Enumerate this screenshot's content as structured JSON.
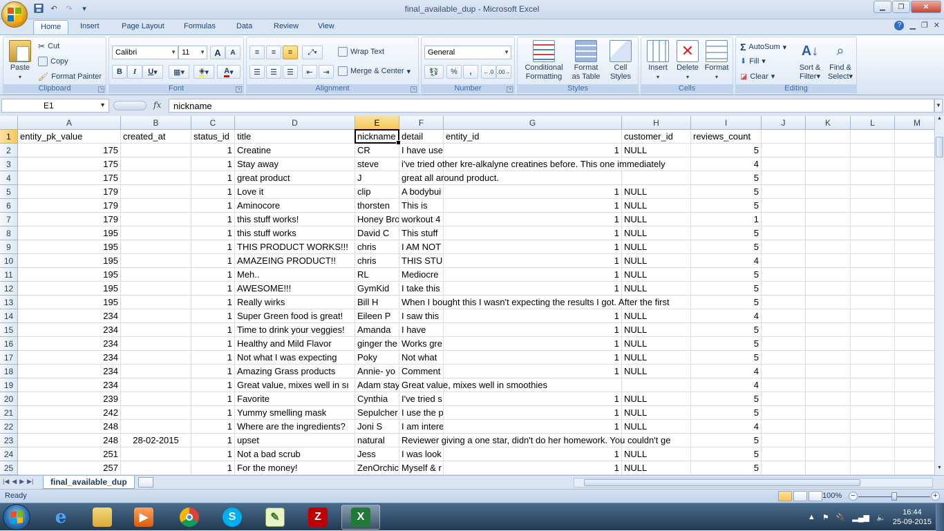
{
  "window": {
    "title": "final_available_dup - Microsoft Excel",
    "controls": [
      "minimize",
      "restore",
      "close"
    ]
  },
  "tabs": [
    {
      "label": "Home",
      "active": true
    },
    {
      "label": "Insert"
    },
    {
      "label": "Page Layout"
    },
    {
      "label": "Formulas"
    },
    {
      "label": "Data"
    },
    {
      "label": "Review"
    },
    {
      "label": "View"
    }
  ],
  "ribbon": {
    "clipboard": {
      "label": "Clipboard",
      "paste": "Paste",
      "cut": "Cut",
      "copy": "Copy",
      "format_painter": "Format Painter"
    },
    "font": {
      "label": "Font",
      "name": "Calibri",
      "size": "11",
      "bold": "B",
      "italic": "I",
      "underline": "U",
      "grow": "A",
      "shrink": "A"
    },
    "alignment": {
      "label": "Alignment",
      "wrap_text": "Wrap Text",
      "merge_center": "Merge & Center"
    },
    "number": {
      "label": "Number",
      "format": "General",
      "percent": "%",
      "comma": ",",
      "inc_dec": ".0 .00",
      "dec_dec": ".00 .0"
    },
    "styles": {
      "label": "Styles",
      "conditional_l1": "Conditional",
      "conditional_l2": "Formatting",
      "format_table_l1": "Format",
      "format_table_l2": "as Table",
      "cell_styles_l1": "Cell",
      "cell_styles_l2": "Styles"
    },
    "cells": {
      "label": "Cells",
      "insert": "Insert",
      "delete": "Delete",
      "format": "Format"
    },
    "editing": {
      "label": "Editing",
      "autosum": "AutoSum",
      "fill": "Fill",
      "clear": "Clear",
      "sort_l1": "Sort &",
      "sort_l2": "Filter",
      "find_l1": "Find &",
      "find_l2": "Select"
    }
  },
  "formula_bar": {
    "name_box": "E1",
    "fx": "fx",
    "content": "nickname"
  },
  "columns": [
    "A",
    "B",
    "C",
    "D",
    "E",
    "F",
    "G",
    "H",
    "I",
    "J",
    "K",
    "L",
    "M"
  ],
  "row_numbers": [
    "1",
    "2",
    "3",
    "4",
    "5",
    "6",
    "7",
    "8",
    "9",
    "10",
    "11",
    "12",
    "13",
    "14",
    "15",
    "16",
    "17",
    "18",
    "19",
    "20",
    "21",
    "22",
    "23",
    "24",
    "25"
  ],
  "rows": [
    {
      "A": "entity_pk_value",
      "B": "created_at",
      "C": "status_id",
      "D": "title",
      "E": "nickname",
      "F": "detail",
      "G": "entity_id",
      "H": "customer_id",
      "I": "reviews_count"
    },
    {
      "A": "175",
      "B": "",
      "C": "1",
      "D": "Creatine",
      "E": "CR",
      "F": "I have use",
      "G": "1",
      "H": "NULL",
      "I": "5"
    },
    {
      "A": "175",
      "B": "",
      "C": "1",
      "D": "Stay away",
      "E": "steve",
      "F": "i've tried other kre-alkalyne creatines before.  This one immediately",
      "G": "",
      "H": "",
      "I": "4"
    },
    {
      "A": "175",
      "B": "",
      "C": "1",
      "D": "great product",
      "E": "J",
      "F": "great all around product.",
      "G": "",
      "H": "",
      "I": "5"
    },
    {
      "A": "179",
      "B": "",
      "C": "1",
      "D": "Love it",
      "E": "clip",
      "F": "A bodybui",
      "G": "1",
      "H": "NULL",
      "I": "5"
    },
    {
      "A": "179",
      "B": "",
      "C": "1",
      "D": "Aminocore",
      "E": "thorsten",
      "F": "This is",
      "G": "1",
      "H": "NULL",
      "I": "5"
    },
    {
      "A": "179",
      "B": "",
      "C": "1",
      "D": "this stuff works!",
      "E": "Honey Bro",
      "F": "workout 4",
      "G": "1",
      "H": "NULL",
      "I": "1"
    },
    {
      "A": "195",
      "B": "",
      "C": "1",
      "D": "this stuff works",
      "E": "David C",
      "F": "This stuff",
      "G": "1",
      "H": "NULL",
      "I": "5"
    },
    {
      "A": "195",
      "B": "",
      "C": "1",
      "D": "THIS PRODUCT WORKS!!!",
      "E": "chris",
      "F": "I AM NOT",
      "G": "1",
      "H": "NULL",
      "I": "5"
    },
    {
      "A": "195",
      "B": "",
      "C": "1",
      "D": "AMAZEING PRODUCT!!",
      "E": "chris",
      "F": "THIS STUF",
      "G": "1",
      "H": "NULL",
      "I": "4"
    },
    {
      "A": "195",
      "B": "",
      "C": "1",
      "D": "Meh..",
      "E": "RL",
      "F": "Mediocre",
      "G": "1",
      "H": "NULL",
      "I": "5"
    },
    {
      "A": "195",
      "B": "",
      "C": "1",
      "D": "AWESOME!!!",
      "E": "GymKid",
      "F": "I take this",
      "G": "1",
      "H": "NULL",
      "I": "5"
    },
    {
      "A": "195",
      "B": "",
      "C": "1",
      "D": "Really wirks",
      "E": "Bill H",
      "F": "When I bought this I wasn't expecting the results I got. After the first",
      "G": "",
      "H": "",
      "I": "5"
    },
    {
      "A": "234",
      "B": "",
      "C": "1",
      "D": "Super Green food is great!",
      "E": "Eileen P",
      "F": "I saw this",
      "G": "1",
      "H": "NULL",
      "I": "4"
    },
    {
      "A": "234",
      "B": "",
      "C": "1",
      "D": "Time to drink your veggies!",
      "E": "Amanda",
      "F": "I have",
      "G": "1",
      "H": "NULL",
      "I": "5"
    },
    {
      "A": "234",
      "B": "",
      "C": "1",
      "D": "Healthy and Mild Flavor",
      "E": "ginger the",
      "F": "Works gre",
      "G": "1",
      "H": "NULL",
      "I": "5"
    },
    {
      "A": "234",
      "B": "",
      "C": "1",
      "D": "Not what I was expecting",
      "E": "Poky",
      "F": "Not what",
      "G": "1",
      "H": "NULL",
      "I": "5"
    },
    {
      "A": "234",
      "B": "",
      "C": "1",
      "D": "Amazing Grass products",
      "E": "Annie- yo",
      "F": "Comment",
      "G": "1",
      "H": "NULL",
      "I": "4"
    },
    {
      "A": "234",
      "B": "",
      "C": "1",
      "D": "Great value, mixes well in sı",
      "E": "Adam stay",
      "F": "Great value, mixes well in smoothies",
      "G": "",
      "H": "",
      "I": "4"
    },
    {
      "A": "239",
      "B": "",
      "C": "1",
      "D": "Favorite",
      "E": "Cynthia",
      "F": "I've tried s",
      "G": "1",
      "H": "NULL",
      "I": "5"
    },
    {
      "A": "242",
      "B": "",
      "C": "1",
      "D": "Yummy smelling mask",
      "E": "Sepulcher",
      "F": "I use the p",
      "G": "1",
      "H": "NULL",
      "I": "5"
    },
    {
      "A": "248",
      "B": "",
      "C": "1",
      "D": "Where are the ingredients?",
      "E": "Joni S",
      "F": "I am intere",
      "G": "1",
      "H": "NULL",
      "I": "4"
    },
    {
      "A": "248",
      "B": "28-02-2015",
      "C": "1",
      "D": "upset",
      "E": "natural",
      "F": "Reviewer giving a one star, didn't do her homework. You couldn't ge",
      "G": "",
      "H": "",
      "I": "5"
    },
    {
      "A": "251",
      "B": "",
      "C": "1",
      "D": "Not a bad scrub",
      "E": "Jess",
      "F": "I was look",
      "G": "1",
      "H": "NULL",
      "I": "5"
    },
    {
      "A": "257",
      "B": "",
      "C": "1",
      "D": "For the money!",
      "E": "ZenOrchic",
      "F": "Myself & r",
      "G": "1",
      "H": "NULL",
      "I": "5"
    }
  ],
  "sheet_tab": "final_available_dup",
  "status": {
    "ready": "Ready",
    "zoom": "100%"
  },
  "taskbar": {
    "time": "16:44",
    "date": "25-09-2015"
  }
}
